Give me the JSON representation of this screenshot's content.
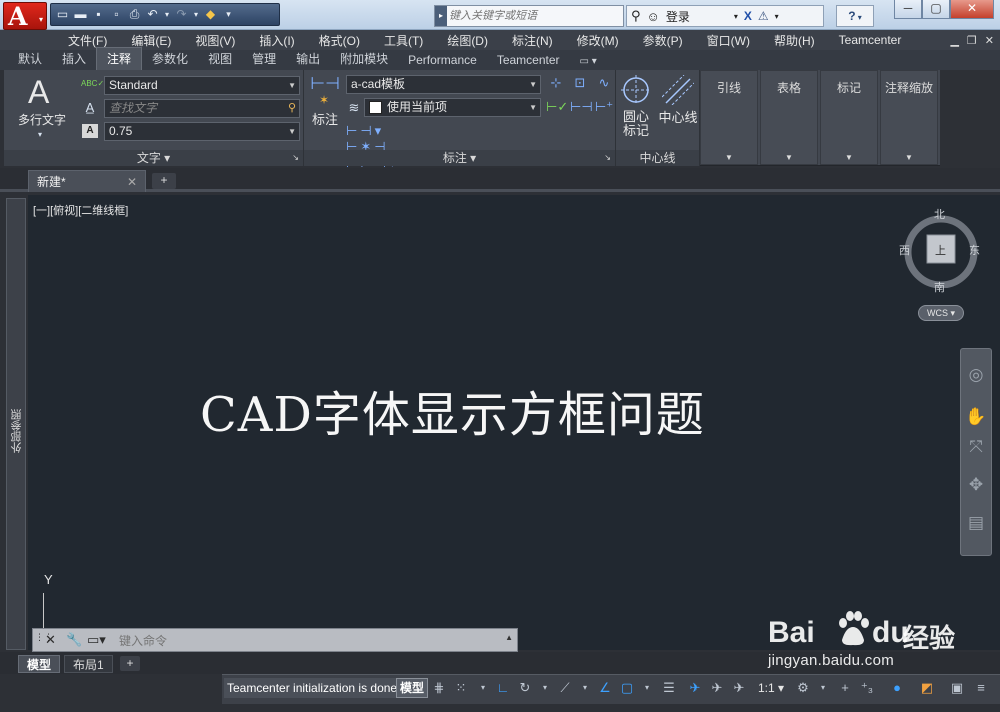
{
  "titlebar": {
    "search_placeholder": "键入关键字或短语",
    "login_label": "登录",
    "help_symbol": "?"
  },
  "menu": [
    "文件(F)",
    "编辑(E)",
    "视图(V)",
    "插入(I)",
    "格式(O)",
    "工具(T)",
    "绘图(D)",
    "标注(N)",
    "修改(M)",
    "参数(P)",
    "窗口(W)",
    "帮助(H)",
    "Teamcenter"
  ],
  "ribbon_tabs": [
    {
      "label": "默认",
      "active": false
    },
    {
      "label": "插入",
      "active": false
    },
    {
      "label": "注释",
      "active": true
    },
    {
      "label": "参数化",
      "active": false
    },
    {
      "label": "视图",
      "active": false
    },
    {
      "label": "管理",
      "active": false
    },
    {
      "label": "输出",
      "active": false
    },
    {
      "label": "附加模块",
      "active": false
    },
    {
      "label": "Performance",
      "active": false
    },
    {
      "label": "Teamcenter",
      "active": false
    }
  ],
  "text_panel": {
    "title": "文字",
    "mtext_label": "多行文字",
    "style_value": "Standard",
    "find_placeholder": "查找文字",
    "height_value": "0.75"
  },
  "dim_panel": {
    "title": "标注",
    "dim_label": "标注",
    "dimstyle_value": "a-cad模板",
    "layer_value": "使用当前项"
  },
  "centerline_panel": {
    "title": "中心线",
    "centermark_label": "圆心\n标记",
    "centerline_label": "中心线"
  },
  "side_panels": [
    "引线",
    "表格",
    "标记",
    "注释缩放"
  ],
  "document_tab": {
    "label": "新建*"
  },
  "view_label": "[一][俯视][二维线框]",
  "drawing_text": "CAD字体显示方框问题",
  "viewcube": {
    "north": "北",
    "south": "南",
    "east": "东",
    "west": "西",
    "top_face": "上",
    "coord": "WCS"
  },
  "ucs_label": "Y",
  "command_line": {
    "placeholder": "键入命令"
  },
  "layout_tabs": [
    "模型",
    "布局1"
  ],
  "sidebar_label": "外部参照",
  "status": {
    "message": "Teamcenter initialization is done",
    "space": "模型",
    "scale": "1:1"
  },
  "watermark": {
    "brand": "Bai",
    "brand2": "du",
    "suffix": "经验",
    "url": "jingyan.baidu.com"
  }
}
